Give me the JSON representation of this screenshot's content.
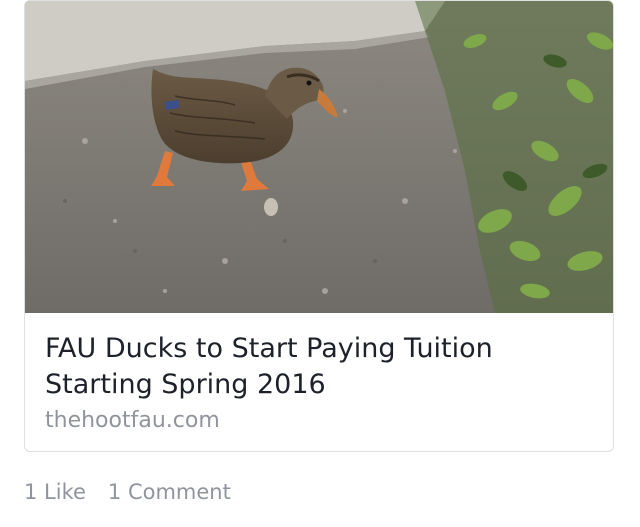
{
  "link_preview": {
    "title": "FAU Ducks to Start Paying Tuition Starting Spring 2016",
    "domain": "thehootfau.com",
    "image_subject": "duck-photo"
  },
  "engagement": {
    "likes": "1 Like",
    "comments": "1 Comment"
  },
  "colors": {
    "title": "#1d2129",
    "muted": "#90949c",
    "border": "#dddfe2"
  }
}
